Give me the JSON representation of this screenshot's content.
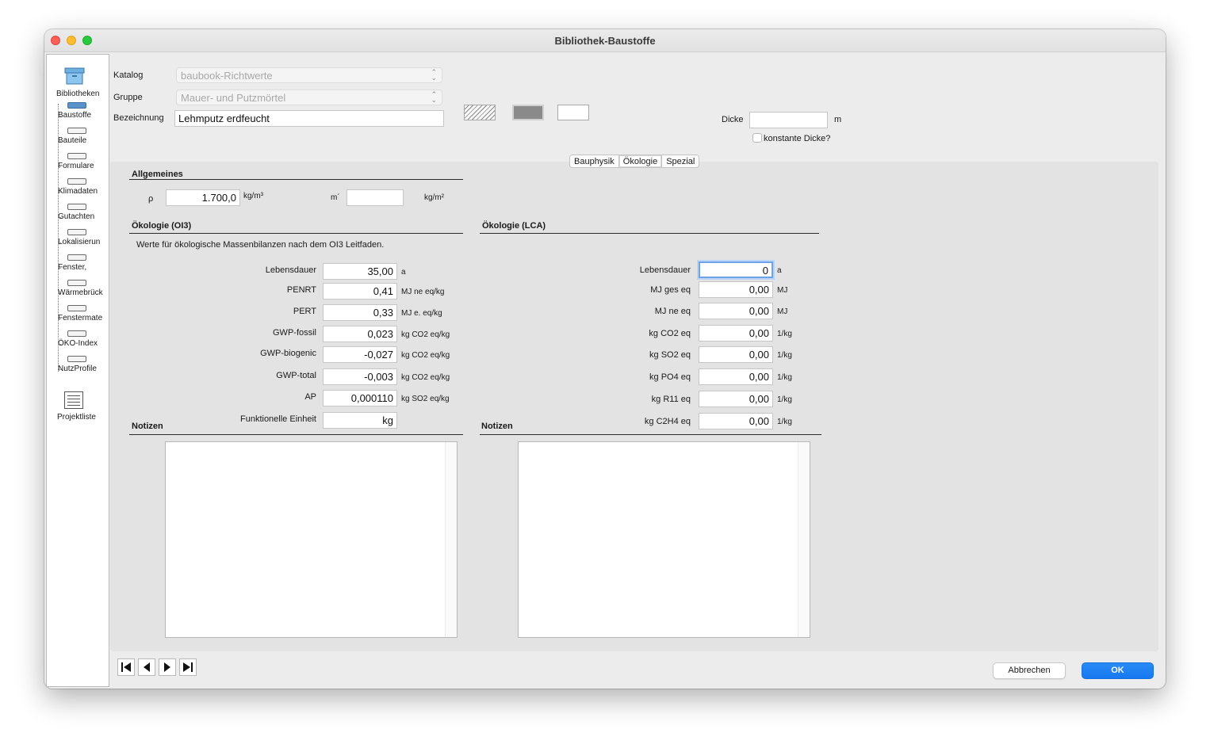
{
  "window": {
    "title": "Bibliothek-Baustoffe"
  },
  "sidebar": {
    "top_label": "Bibliotheken",
    "items": [
      {
        "label": "Baustoffe",
        "selected": true
      },
      {
        "label": "Bauteile"
      },
      {
        "label": "Formulare"
      },
      {
        "label": "Klimadaten"
      },
      {
        "label": "Gutachten"
      },
      {
        "label": "Lokalisierun"
      },
      {
        "label": "Fenster,"
      },
      {
        "label": "Wärmebrück"
      },
      {
        "label": "Fenstermate"
      },
      {
        "label": "ÖKO-Index"
      },
      {
        "label": "NutzProfile"
      }
    ],
    "bottom_label": "Projektliste"
  },
  "header": {
    "katalog_label": "Katalog",
    "katalog_value": "baubook-Richtwerte",
    "gruppe_label": "Gruppe",
    "gruppe_value": "Mauer- und Putzmörtel",
    "bezeichnung_label": "Bezeichnung",
    "bezeichnung_value": "Lehmputz erdfeucht",
    "dicke_label": "Dicke",
    "dicke_value": "",
    "dicke_unit": "m",
    "konstante_label": "konstante Dicke?",
    "swatch_colors": [
      "#f8f8f8",
      "#8a8a8a",
      "#ffffff"
    ]
  },
  "tabs": [
    {
      "label": "Bauphysik"
    },
    {
      "label": "Ökologie",
      "active": true
    },
    {
      "label": "Spezial"
    }
  ],
  "allgemeines": {
    "title": "Allgemeines",
    "rho_label": "ρ",
    "rho_value": "1.700,0",
    "rho_unit": "kg/m³",
    "m_label": "m´",
    "m_value": "",
    "m_unit": "kg/m²"
  },
  "oi3": {
    "title": "Ökologie (OI3)",
    "description": "Werte für ökologische Massenbilanzen nach dem OI3 Leitfaden.",
    "rows": [
      {
        "label": "Lebensdauer",
        "value": "35,00",
        "unit": "a"
      },
      {
        "label": "PENRT",
        "value": "0,41",
        "unit": "MJ ne eq/kg"
      },
      {
        "label": "PERT",
        "value": "0,33",
        "unit": "MJ e. eq/kg"
      },
      {
        "label": "GWP-fossil",
        "value": "0,023",
        "unit": "kg CO2 eq/kg"
      },
      {
        "label": "GWP-biogenic",
        "value": "-0,027",
        "unit": "kg CO2 eq/kg"
      },
      {
        "label": "GWP-total",
        "value": "-0,003",
        "unit": "kg CO2 eq/kg"
      },
      {
        "label": "AP",
        "value": "0,000110",
        "unit": "kg SO2 eq/kg"
      },
      {
        "label": "Funktionelle Einheit",
        "value": "kg",
        "unit": ""
      }
    ],
    "notes_title": "Notizen"
  },
  "lca": {
    "title": "Ökologie (LCA)",
    "rows": [
      {
        "label": "Lebensdauer",
        "value": "0",
        "unit": "a"
      },
      {
        "label": "MJ ges eq",
        "value": "0,00",
        "unit": "MJ"
      },
      {
        "label": "MJ ne eq",
        "value": "0,00",
        "unit": "MJ"
      },
      {
        "label": "kg CO2 eq",
        "value": "0,00",
        "unit": "1/kg"
      },
      {
        "label": "kg SO2 eq",
        "value": "0,00",
        "unit": "1/kg"
      },
      {
        "label": "kg PO4 eq",
        "value": "0,00",
        "unit": "1/kg"
      },
      {
        "label": "kg R11 eq",
        "value": "0,00",
        "unit": "1/kg"
      },
      {
        "label": "kg C2H4 eq",
        "value": "0,00",
        "unit": "1/kg"
      }
    ],
    "notes_title": "Notizen"
  },
  "footer": {
    "cancel_label": "Abbrechen",
    "ok_label": "OK"
  }
}
